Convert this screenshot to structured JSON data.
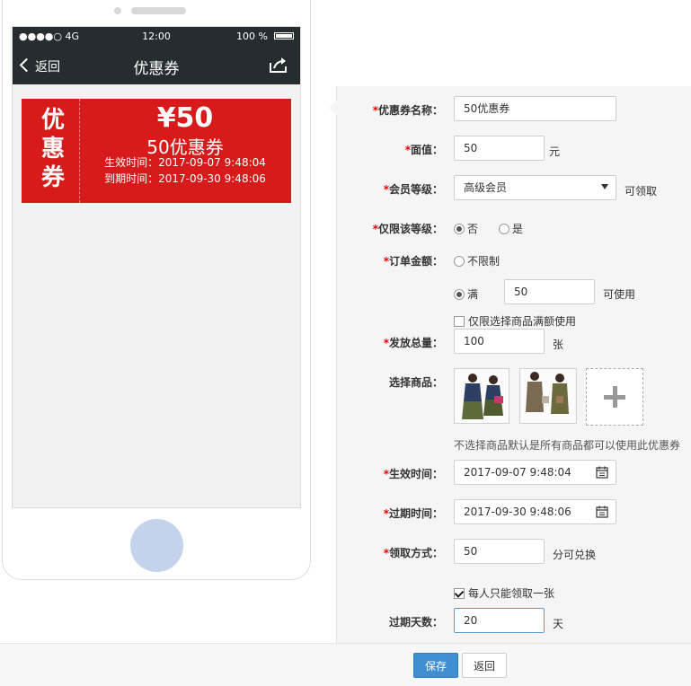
{
  "phone": {
    "status": {
      "signal": "●●●●○ 4G",
      "time": "12:00",
      "battery": "100 %"
    },
    "nav": {
      "back_label": "返回",
      "title": "优惠券"
    },
    "coupon": {
      "vertical_label": [
        "优",
        "惠",
        "券"
      ],
      "amount": "¥50",
      "name": "50优惠券",
      "effective": "生效时间：2017-09-07 9:48:04",
      "expire": "到期时间：2017-09-30 9:48:06",
      "color": "#d71a1a"
    }
  },
  "form": {
    "name": {
      "label": "优惠券名称：",
      "value": "50优惠券"
    },
    "face_value": {
      "label": "面值：",
      "value": "50",
      "unit": "元"
    },
    "member_level": {
      "label": "会员等级：",
      "selected": "高级会员",
      "suffix": "可领取"
    },
    "level_only": {
      "label": "仅限该等级：",
      "options": [
        "否",
        "是"
      ],
      "selected": "否"
    },
    "order_amount": {
      "label": "订单金额：",
      "unlimited_label": "不限制",
      "full_label": "满",
      "full_value": "50",
      "full_suffix": "可使用",
      "selected": "满",
      "only_selected_goods_label": "仅限选择商品满额使用",
      "only_selected_goods_checked": false
    },
    "total": {
      "label": "发放总量：",
      "value": "100",
      "unit": "张"
    },
    "goods": {
      "label": "选择商品：",
      "hint": "不选择商品默认是所有商品都可以使用此优惠券"
    },
    "start_time": {
      "label": "生效时间：",
      "value": "2017-09-07 9:48:04"
    },
    "end_time": {
      "label": "过期时间：",
      "value": "2017-09-30 9:48:06"
    },
    "claim": {
      "label": "领取方式：",
      "value": "50",
      "suffix": "分可兑换"
    },
    "once_per_person": {
      "label": "每人只能领取一张",
      "checked": true
    },
    "expire_days": {
      "label": "过期天数：",
      "value": "20",
      "unit": "天"
    },
    "required_mark": "*"
  },
  "footer": {
    "save_label": "保存",
    "back_label": "返回"
  }
}
